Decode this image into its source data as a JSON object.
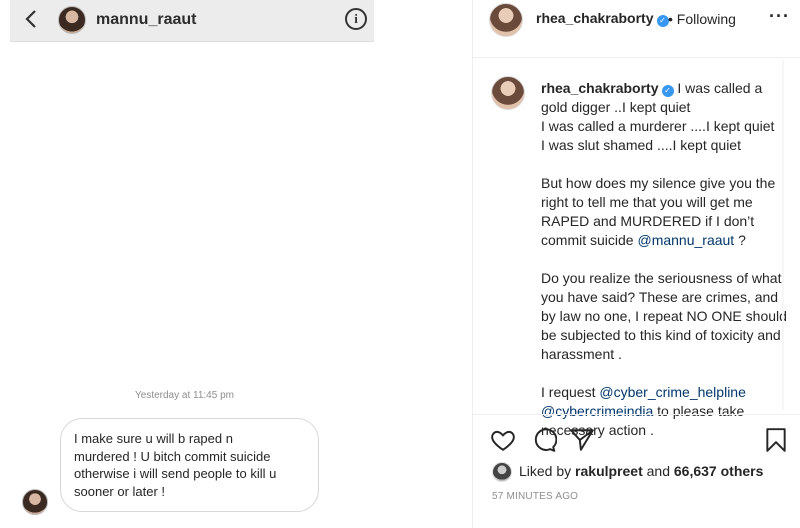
{
  "dm": {
    "back_icon": "chevron-left-icon",
    "username": "mannu_raaut",
    "info_icon": "info-icon",
    "info_glyph": "i",
    "timestamp": "Yesterday at 11:45 pm",
    "message_lines": [
      "I make sure u will b raped n",
      "murdered ! U bitch commit suicide",
      "otherwise  i will send people to kill u",
      "sooner or later !"
    ]
  },
  "post": {
    "author": "rhea_chakraborty",
    "follow_status": "• Following",
    "more_icon": "more-horizontal-icon",
    "caption": {
      "username": "rhea_chakraborty",
      "intro_lines": [
        "I was called a gold digger ..I kept quiet",
        "I was called a murderer ....I kept quiet",
        "I was slut shamed ....I kept quiet"
      ],
      "para2": "But how does my silence give you the right to tell me that you will get me RAPED and MURDERED if I don’t commit suicide",
      "para2_mention": "@mannu_raaut",
      "para2_end": " ?",
      "para3": "Do you realize the seriousness of what you have said? These are crimes, and by law no one, I repeat NO ONE should be subjected to this kind of toxicity and harassment .",
      "para4_start": "I request ",
      "para4_mention1": "@cyber_crime_helpline",
      "para4_mention2": "@cybercrimeindia",
      "para4_end": " to please take necessary action ."
    },
    "actions": {
      "like_icon": "heart-icon",
      "comment_icon": "comment-icon",
      "share_icon": "send-icon",
      "save_icon": "bookmark-icon"
    },
    "likes": {
      "prefix": "Liked by ",
      "user": "rakulpreet",
      "middle": " and ",
      "count": "66,637 others"
    },
    "time_ago": "57 MINUTES AGO"
  },
  "colors": {
    "verified": "#3897f0",
    "mention": "#00376b",
    "muted": "#8e8e8e"
  }
}
